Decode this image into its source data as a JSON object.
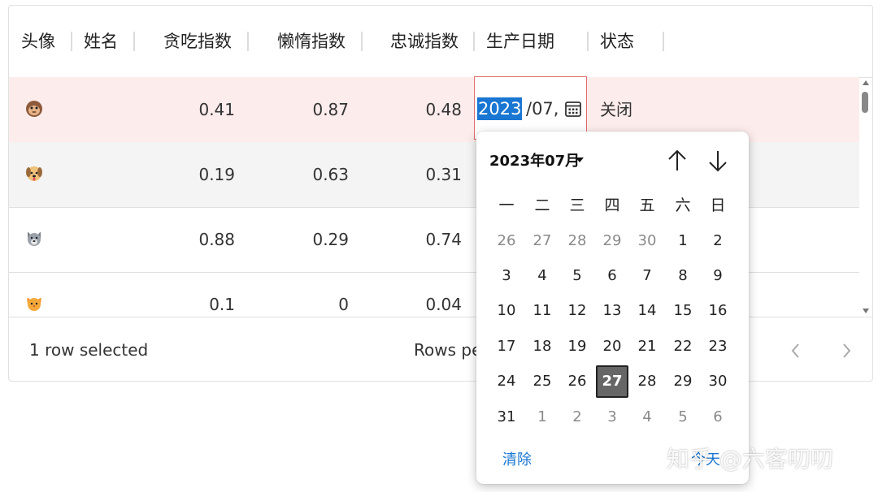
{
  "columns": {
    "avatar": "头像",
    "name": "姓名",
    "greed": "贪吃指数",
    "lazy": "懒惰指数",
    "loyal": "忠诚指数",
    "date": "生产日期",
    "status": "状态"
  },
  "rows": [
    {
      "avatar": "monkey-face",
      "greed": "0.41",
      "lazy": "0.87",
      "loyal": "0.48",
      "status": "关闭"
    },
    {
      "avatar": "dog-face",
      "greed": "0.19",
      "lazy": "0.63",
      "loyal": "0.31",
      "status": ""
    },
    {
      "avatar": "wolf-face",
      "greed": "0.88",
      "lazy": "0.29",
      "loyal": "0.74",
      "status": ""
    },
    {
      "avatar": "cat-face",
      "greed": "0.1",
      "lazy": "0",
      "loyal": "0.04",
      "status": ""
    }
  ],
  "editing": {
    "year_selected": "2023",
    "rest": "/07,"
  },
  "footer": {
    "selected_text": "1 row selected",
    "rows_per_page_label": "Rows pe"
  },
  "picker": {
    "month_label": "2023年07月",
    "weekdays": [
      "一",
      "二",
      "三",
      "四",
      "五",
      "六",
      "日"
    ],
    "days": [
      [
        "26",
        "27",
        "28",
        "29",
        "30",
        "1",
        "2"
      ],
      [
        "3",
        "4",
        "5",
        "6",
        "7",
        "8",
        "9"
      ],
      [
        "10",
        "11",
        "12",
        "13",
        "14",
        "15",
        "16"
      ],
      [
        "17",
        "18",
        "19",
        "20",
        "21",
        "22",
        "23"
      ],
      [
        "24",
        "25",
        "26",
        "27",
        "28",
        "29",
        "30"
      ],
      [
        "31",
        "1",
        "2",
        "3",
        "4",
        "5",
        "6"
      ]
    ],
    "selected_day": "27",
    "clear": "清除",
    "today": "今天"
  },
  "watermark": "知乎 @六客叨叨",
  "colors": {
    "selected_row": "#fdecec",
    "hover_row": "#f4f4f4",
    "accent": "#1976d2",
    "edit_border": "#e06b6b"
  }
}
